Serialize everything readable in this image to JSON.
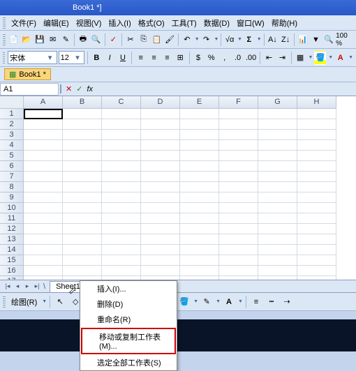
{
  "title": "Book1 *]",
  "menus": [
    "文件(F)",
    "编辑(E)",
    "视图(V)",
    "插入(I)",
    "格式(O)",
    "工具(T)",
    "数据(D)",
    "窗口(W)",
    "帮助(H)"
  ],
  "font_name": "宋体",
  "font_size": "12",
  "zoom": "100 %",
  "doc_tab": "Book1 *",
  "active_cell": "A1",
  "fx_label": "fx",
  "columns": [
    "A",
    "B",
    "C",
    "D",
    "E",
    "F",
    "G",
    "H"
  ],
  "row_count": 17,
  "sheet_name": "Sheet1",
  "draw_label": "绘图(R)",
  "context_menu": {
    "insert": "插入(I)...",
    "delete": "删除(D)",
    "rename": "重命名(R)",
    "move_copy": "移动或复制工作表(M)...",
    "select_all": "选定全部工作表(S)"
  }
}
